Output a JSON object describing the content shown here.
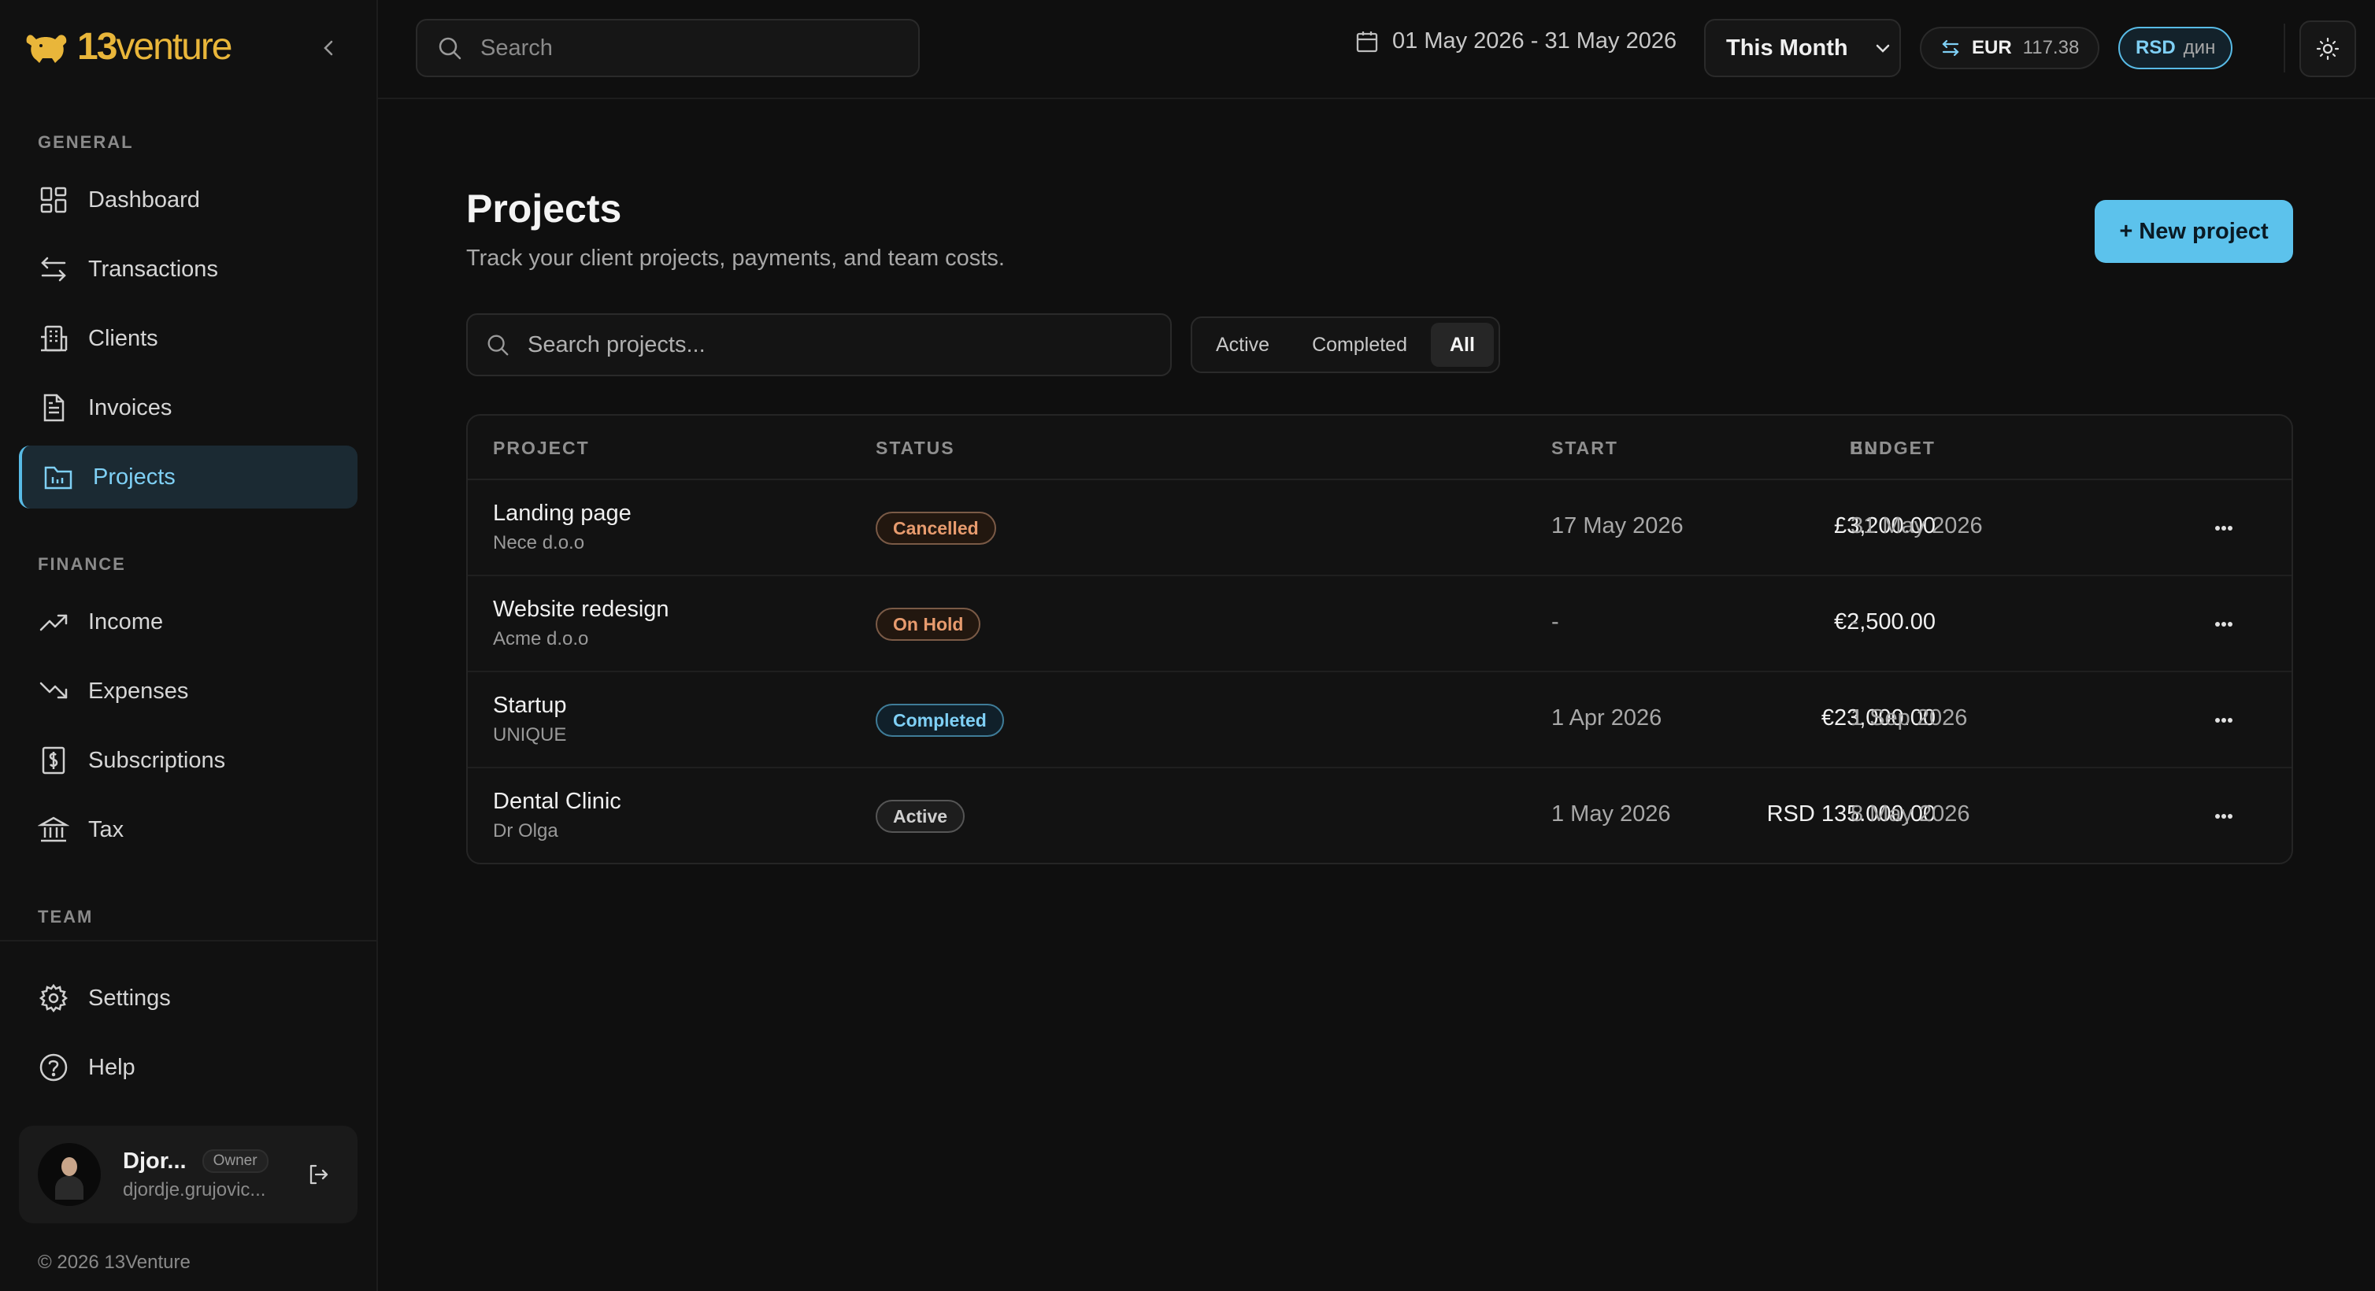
{
  "brand": {
    "name_bold": "13",
    "name_light": "venture"
  },
  "sidebar": {
    "sections": {
      "general": "GENERAL",
      "finance": "FINANCE",
      "team": "TEAM"
    },
    "general_items": [
      {
        "label": "Dashboard",
        "icon": "dashboard-icon"
      },
      {
        "label": "Transactions",
        "icon": "transactions-icon"
      },
      {
        "label": "Clients",
        "icon": "clients-icon"
      },
      {
        "label": "Invoices",
        "icon": "invoices-icon"
      },
      {
        "label": "Projects",
        "icon": "projects-icon",
        "active": true
      }
    ],
    "finance_items": [
      {
        "label": "Income",
        "icon": "income-icon"
      },
      {
        "label": "Expenses",
        "icon": "expenses-icon"
      },
      {
        "label": "Subscriptions",
        "icon": "subscriptions-icon"
      },
      {
        "label": "Tax",
        "icon": "tax-icon"
      }
    ],
    "bottom_items": [
      {
        "label": "Settings",
        "icon": "gear-icon"
      },
      {
        "label": "Help",
        "icon": "help-icon"
      }
    ],
    "user": {
      "name": "Djor...",
      "role": "Owner",
      "email": "djordje.grujovic..."
    },
    "copyright": "© 2026 13Venture"
  },
  "topbar": {
    "search_placeholder": "Search",
    "date_range": "01 May 2026 - 31 May 2026",
    "period": "This Month",
    "currency": {
      "code": "EUR",
      "rate": "117.38"
    },
    "secondary_currency": {
      "code": "RSD",
      "symbol": "дин"
    }
  },
  "page": {
    "title": "Projects",
    "subtitle": "Track your client projects, payments, and team costs.",
    "new_button": "+ New project",
    "search_placeholder": "Search projects...",
    "filters": [
      "Active",
      "Completed",
      "All"
    ],
    "active_filter": "All"
  },
  "table": {
    "headers": {
      "project": "PROJECT",
      "status": "STATUS",
      "budget": "BUDGET",
      "start": "START",
      "end": "END"
    },
    "rows": [
      {
        "name": "Landing page",
        "client": "Nece d.o.o",
        "status": "Cancelled",
        "status_class": "cancelled",
        "budget": "£3,200.00",
        "start": "17 May 2026",
        "end": "31 May 2026"
      },
      {
        "name": "Website redesign",
        "client": "Acme d.o.o",
        "status": "On Hold",
        "status_class": "onhold",
        "budget": "€2,500.00",
        "start": "-",
        "end": "-"
      },
      {
        "name": "Startup",
        "client": "UNIQUE",
        "status": "Completed",
        "status_class": "completed",
        "budget": "€23,000.00",
        "start": "1 Apr 2026",
        "end": "1 Sep 2026"
      },
      {
        "name": "Dental Clinic",
        "client": "Dr Olga",
        "status": "Active",
        "status_class": "active",
        "budget": "RSD 135.000,00",
        "start": "1 May 2026",
        "end": "8 May 2026"
      }
    ]
  },
  "colors": {
    "accent": "#5cc2ec",
    "brand": "#e9b63a",
    "background": "#0f0f0f"
  }
}
